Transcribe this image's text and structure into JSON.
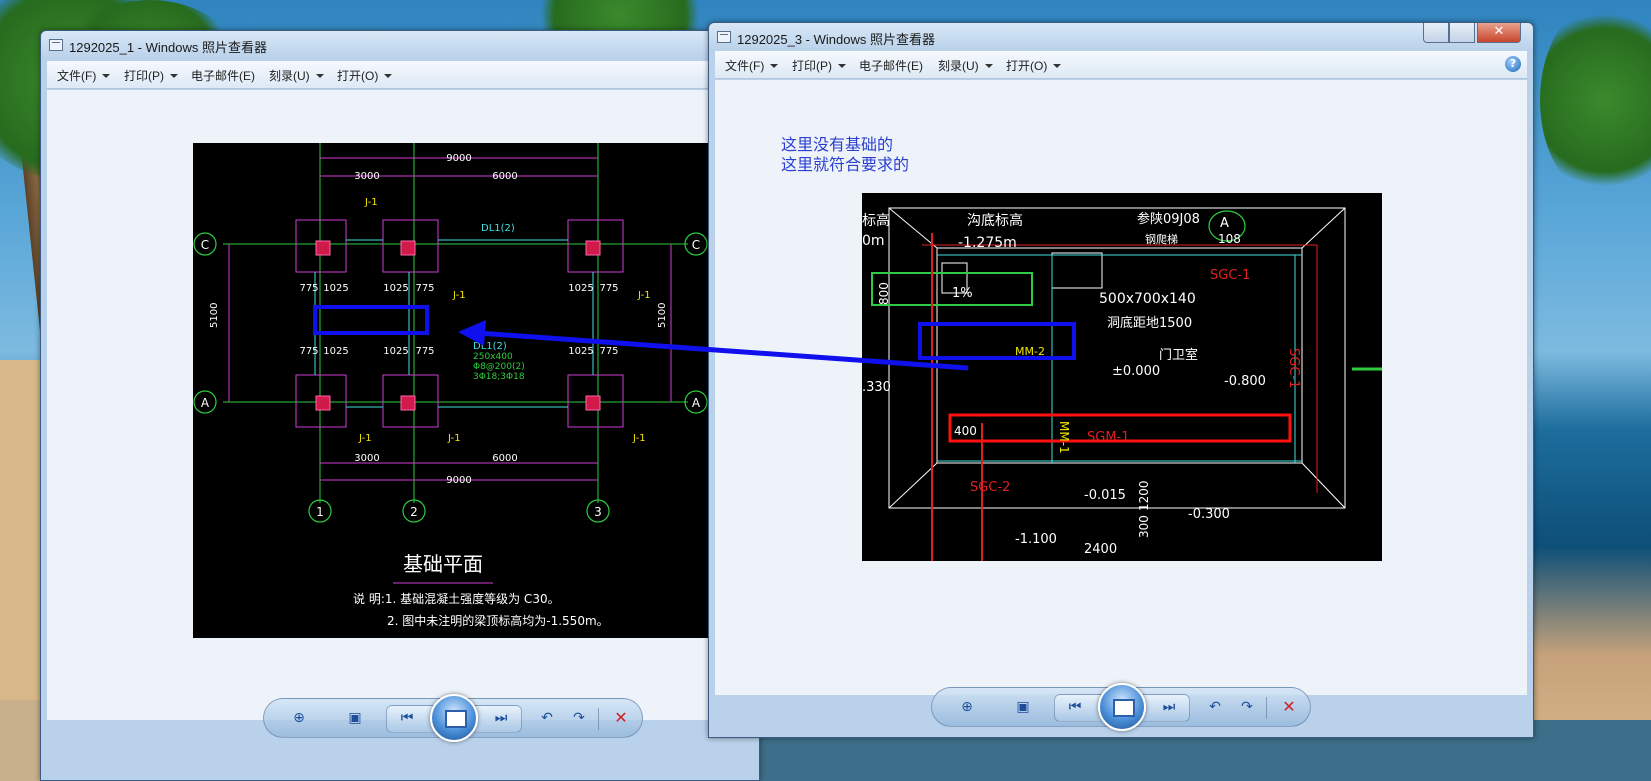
{
  "window1": {
    "title": "1292025_1 - Windows 照片查看器",
    "menu": [
      "文件(F)",
      "打印(P)",
      "电子邮件(E)",
      "刻录(U)",
      "打开(O)"
    ]
  },
  "window2": {
    "title": "1292025_3 - Windows 照片查看器",
    "menu": [
      "文件(F)",
      "打印(P)",
      "电子邮件(E)",
      "刻录(U)",
      "打开(O)"
    ],
    "annotation_line1": "这里没有基础的",
    "annotation_line2": "这里就符合要求的",
    "close_glyph": "✕"
  },
  "toolbar": {
    "zoom_glyph": "⊕",
    "fit_glyph": "▣",
    "prev_glyph": "⏮",
    "next_glyph": "⏭",
    "rotate_ccw_glyph": "↶",
    "rotate_cw_glyph": "↷",
    "delete_glyph": "✕"
  },
  "drawing1": {
    "title": "基础平面",
    "note1": "说 明:1. 基础混凝土强度等级为 C30。",
    "note2": "2. 图中未注明的梁顶标高均为-1.550m。",
    "dim_total": "9000",
    "dim_a": "3000",
    "dim_b": "6000",
    "dim_side": "5100",
    "dim_775": "775",
    "dim_1025": "1025",
    "footing": "J-1",
    "beam_label": "DL1(2)",
    "beam_size": "250x400",
    "beam_stirrup": "Φ8@200(2)",
    "beam_bars": "3Φ18;3Φ18",
    "axis_c": "C",
    "axis_a": "A",
    "axis_1": "1",
    "axis_2": "2",
    "axis_3": "3"
  },
  "drawing2": {
    "trench_label": "沟底标高",
    "trench_level": "-1.275m",
    "ref": "参陕09J08",
    "ref_sub": "钢爬梯",
    "axis_a": "A",
    "ref_no": "108",
    "sgc1": "SGC-1",
    "sgc2": "SGC-2",
    "size": "500x700x140",
    "depth": "洞底距地1500",
    "room": "门卫室",
    "level0": "±0.000",
    "level_minus080": "-0.800",
    "slope": "1%",
    "h800": "800",
    "left_high": "标高",
    "left_m": "0m",
    "left_330": ".330",
    "mm2": "MM-2",
    "sgm1": "SGM-1",
    "mm1": "MM-1",
    "d400": "400",
    "l015": "-0.015",
    "d1200": "1200",
    "d300": "300",
    "l0300": "-0.300",
    "l1100": "-1.100",
    "d2400": "2400"
  }
}
